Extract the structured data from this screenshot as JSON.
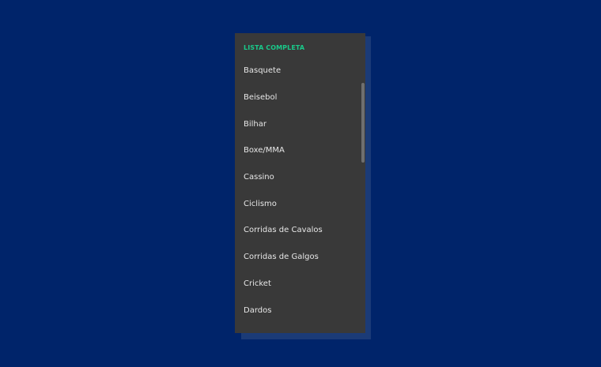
{
  "panel": {
    "title": "LISTA COMPLETA",
    "items": [
      "Basquete",
      "Beisebol",
      "Bilhar",
      "Boxe/MMA",
      "Cassino",
      "Ciclismo",
      "Corridas de Cavalos",
      "Corridas de Galgos",
      "Cricket",
      "Dardos"
    ]
  },
  "colors": {
    "page_background": "#00246a",
    "panel_background": "#393939",
    "title_accent": "#19c98a",
    "item_text": "#e7e7e7",
    "scrollbar_thumb": "#6f6f6f"
  }
}
